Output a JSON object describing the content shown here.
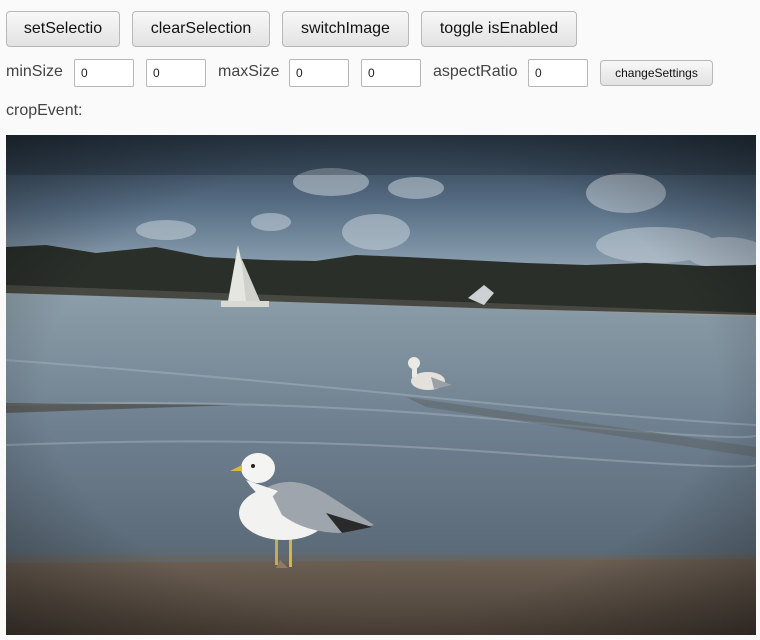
{
  "toolbar": {
    "set_selection_label": "setSelectio",
    "clear_selection_label": "clearSelection",
    "switch_image_label": "switchImage",
    "toggle_enabled_label": "toggle isEnabled"
  },
  "settings": {
    "min_size_label": "minSize",
    "min_size_w": "0",
    "min_size_h": "0",
    "max_size_label": "maxSize",
    "max_size_w": "0",
    "max_size_h": "0",
    "aspect_ratio_label": "aspectRatio",
    "aspect_ratio_value": "0",
    "change_settings_label": "changeSettings"
  },
  "crop_event": {
    "label": "cropEvent:",
    "value": ""
  },
  "image": {
    "subject": "seagulls on beach with sailboat"
  }
}
